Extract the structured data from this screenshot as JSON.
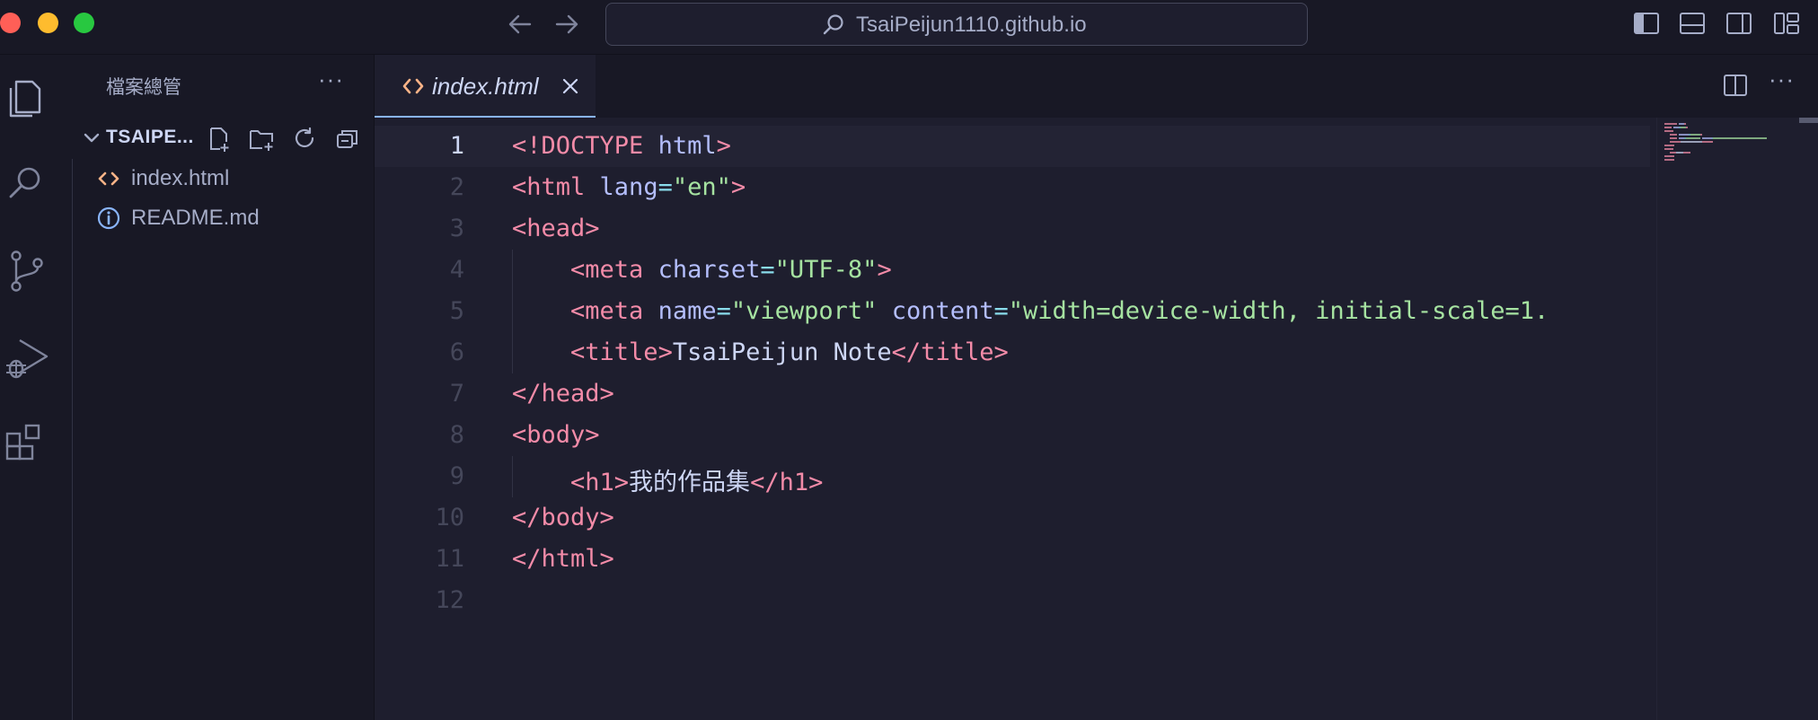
{
  "window": {
    "search_text": "TsaiPeijun1110.github.io",
    "traffic_lights": [
      "#ff5f57",
      "#febc2e",
      "#28c840"
    ]
  },
  "activity_bar": {
    "items": [
      "files-icon",
      "search-icon",
      "source-control-icon",
      "run-debug-icon",
      "extensions-icon"
    ]
  },
  "sidebar": {
    "title": "檔案總管",
    "more": "···",
    "folder_name": "TSAIPE...",
    "files": [
      {
        "name": "index.html",
        "icon": "html-file-icon",
        "icon_color": "#fab387"
      },
      {
        "name": "README.md",
        "icon": "info-icon",
        "icon_color": "#89b4fa"
      }
    ]
  },
  "editor": {
    "tab_label": "index.html",
    "tab_icon_color": "#fab387",
    "more": "···",
    "current_line": 1,
    "lines": [
      {
        "n": "1",
        "tokens": [
          [
            "t-name",
            "<!DOCTYPE"
          ],
          [
            "t-text",
            " "
          ],
          [
            "t-attr",
            "html"
          ],
          [
            "t-name",
            ">"
          ]
        ]
      },
      {
        "n": "2",
        "tokens": [
          [
            "t-name",
            "<html"
          ],
          [
            "t-text",
            " "
          ],
          [
            "t-attr",
            "lang"
          ],
          [
            "t-eq",
            "="
          ],
          [
            "t-str",
            "\"en\""
          ],
          [
            "t-name",
            ">"
          ]
        ]
      },
      {
        "n": "3",
        "tokens": [
          [
            "t-name",
            "<head>"
          ]
        ]
      },
      {
        "n": "4",
        "tokens": [
          [
            "t-text",
            "    "
          ],
          [
            "t-name",
            "<meta"
          ],
          [
            "t-text",
            " "
          ],
          [
            "t-attr",
            "charset"
          ],
          [
            "t-eq",
            "="
          ],
          [
            "t-str",
            "\"UTF-8\""
          ],
          [
            "t-name",
            ">"
          ]
        ]
      },
      {
        "n": "5",
        "tokens": [
          [
            "t-text",
            "    "
          ],
          [
            "t-name",
            "<meta"
          ],
          [
            "t-text",
            " "
          ],
          [
            "t-attr",
            "name"
          ],
          [
            "t-eq",
            "="
          ],
          [
            "t-str",
            "\"viewport\""
          ],
          [
            "t-text",
            " "
          ],
          [
            "t-attr",
            "content"
          ],
          [
            "t-eq",
            "="
          ],
          [
            "t-str",
            "\"width=device-width, initial-scale=1."
          ]
        ]
      },
      {
        "n": "6",
        "tokens": [
          [
            "t-text",
            "    "
          ],
          [
            "t-name",
            "<title>"
          ],
          [
            "t-text",
            "TsaiPeijun Note"
          ],
          [
            "t-name",
            "</title>"
          ]
        ]
      },
      {
        "n": "7",
        "tokens": [
          [
            "t-name",
            "</head>"
          ]
        ]
      },
      {
        "n": "8",
        "tokens": [
          [
            "t-name",
            "<body>"
          ]
        ]
      },
      {
        "n": "9",
        "tokens": [
          [
            "t-text",
            "    "
          ],
          [
            "t-name",
            "<h1>"
          ],
          [
            "t-text t-chi",
            "我的作品集"
          ],
          [
            "t-name",
            "</h1>"
          ]
        ]
      },
      {
        "n": "10",
        "tokens": [
          [
            "t-name",
            "</body>"
          ]
        ]
      },
      {
        "n": "11",
        "tokens": [
          [
            "t-name",
            "</html>"
          ]
        ]
      },
      {
        "n": "12",
        "tokens": []
      }
    ]
  }
}
